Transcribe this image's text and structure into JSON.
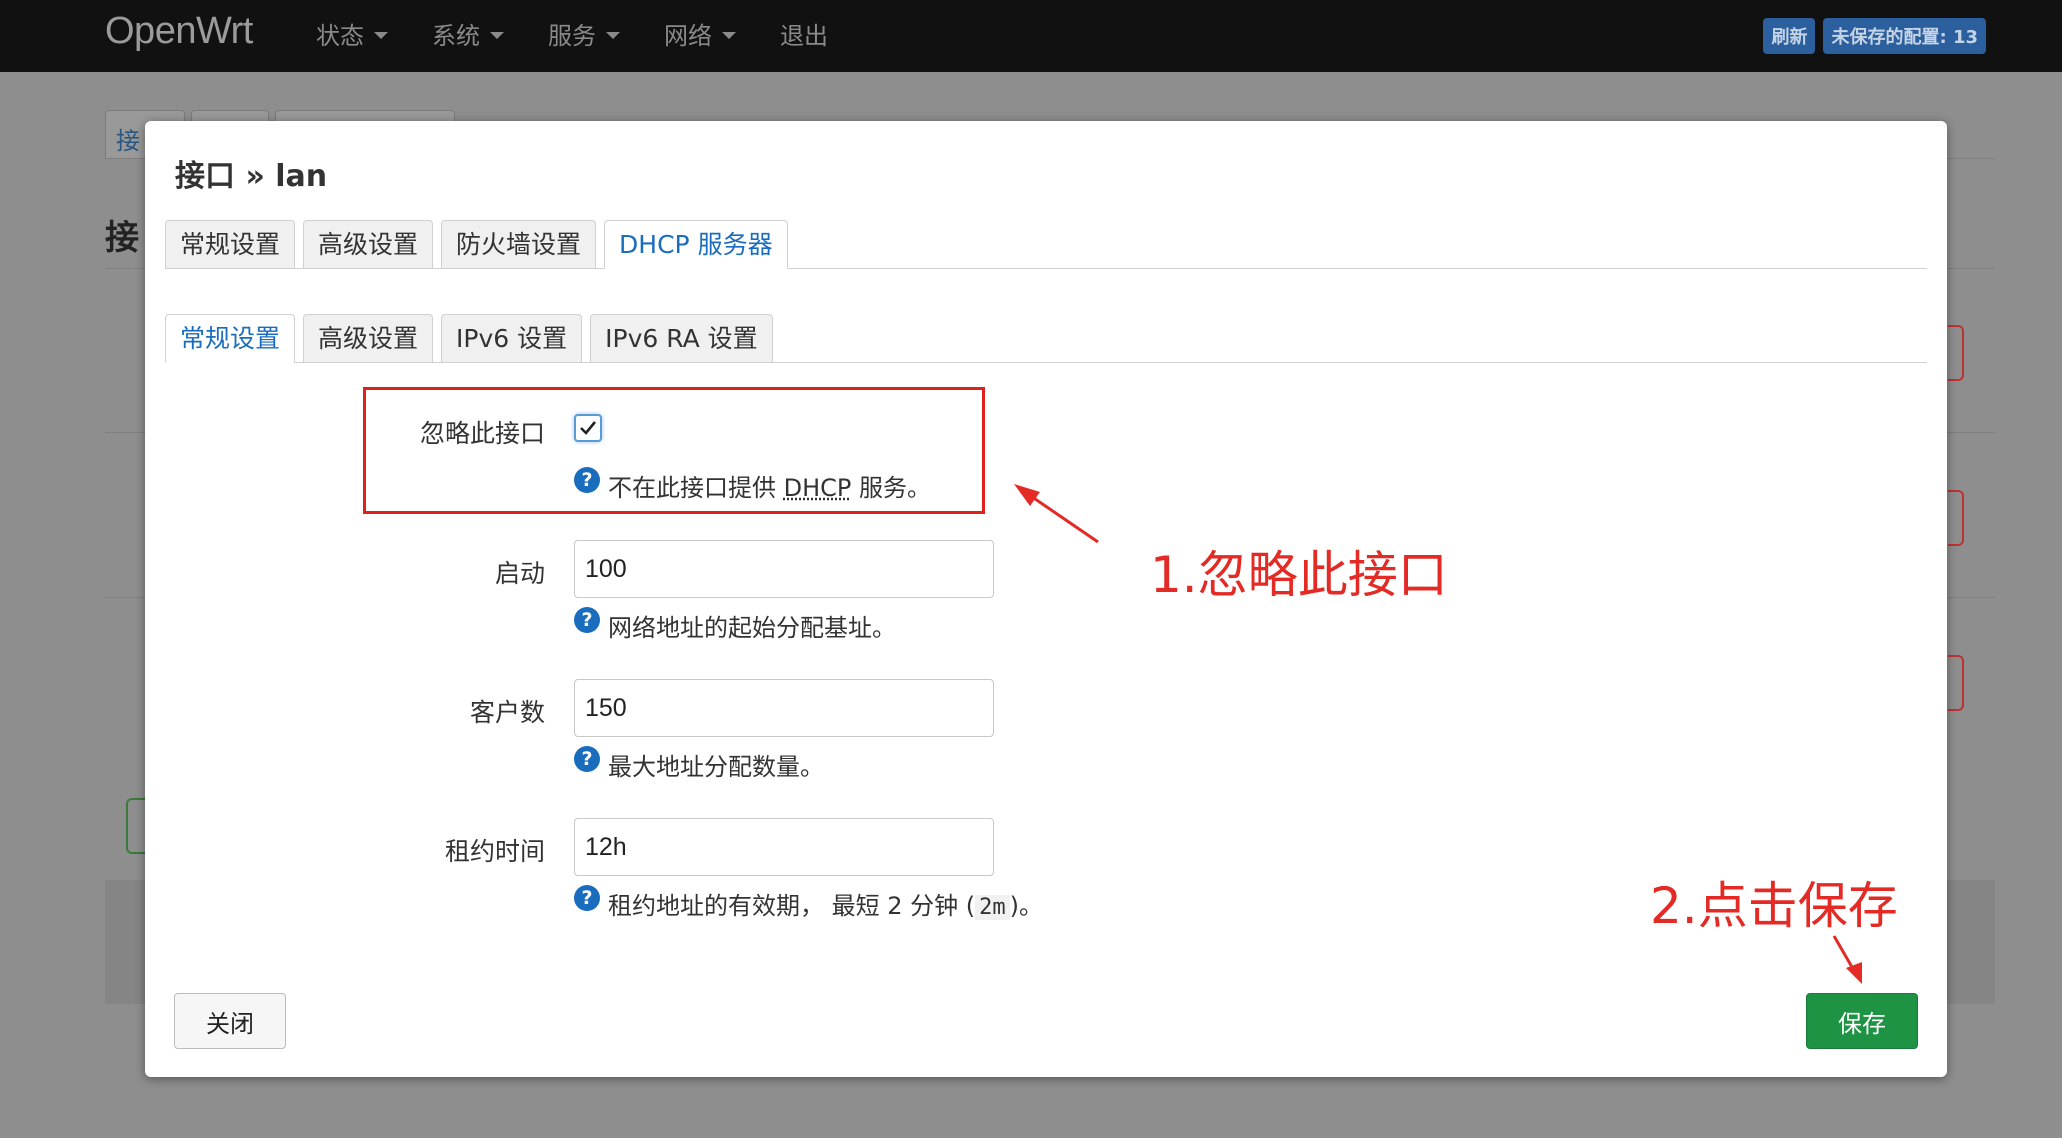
{
  "navbar": {
    "brand": "OpenWrt",
    "menu": [
      {
        "label": "状态",
        "dropdown": true
      },
      {
        "label": "系统",
        "dropdown": true
      },
      {
        "label": "服务",
        "dropdown": true
      },
      {
        "label": "网络",
        "dropdown": true
      },
      {
        "label": "退出",
        "dropdown": false
      }
    ],
    "refresh_label": "刷新",
    "unsaved_label": "未保存的配置: 13"
  },
  "background": {
    "tab_first": "接",
    "title": "接"
  },
  "modal": {
    "title": "接口 » lan",
    "main_tabs": [
      "常规设置",
      "高级设置",
      "防火墙设置",
      "DHCP 服务器"
    ],
    "main_active": 3,
    "sub_tabs": [
      "常规设置",
      "高级设置",
      "IPv6 设置",
      "IPv6 RA 设置"
    ],
    "sub_active": 0,
    "ignore": {
      "label": "忽略此接口",
      "checked": true,
      "help_prefix": "不在此接口提供 ",
      "help_abbr": "DHCP",
      "help_suffix": " 服务。"
    },
    "start": {
      "label": "启动",
      "value": "100",
      "help": "网络地址的起始分配基址。"
    },
    "limit": {
      "label": "客户数",
      "value": "150",
      "help": "最大地址分配数量。"
    },
    "leasetime": {
      "label": "租约时间",
      "value": "12h",
      "help_prefix": "租约地址的有效期， 最短 2 分钟 (",
      "help_code": "2m",
      "help_suffix": ")。"
    },
    "close_label": "关闭",
    "save_label": "保存"
  },
  "annotations": {
    "step1": "1.忽略此接口",
    "step2": "2.点击保存",
    "color": "#e42a25"
  }
}
